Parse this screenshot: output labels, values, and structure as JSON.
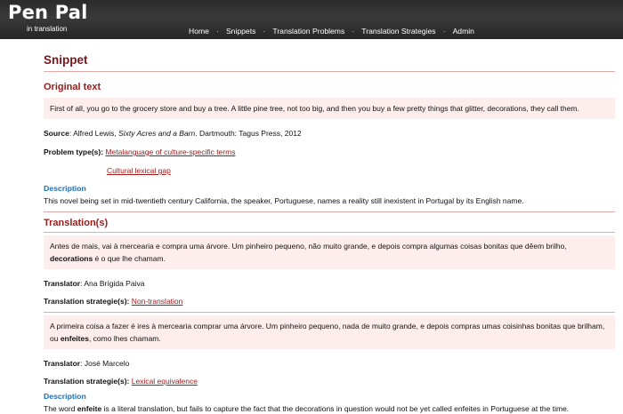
{
  "brand": {
    "title": "Pen Pal",
    "subtitle": "in translation"
  },
  "nav": [
    "Home",
    "Snippets",
    "Translation Problems",
    "Translation Strategies",
    "Admin"
  ],
  "page_title": "Snippet",
  "original": {
    "heading": "Original text",
    "text": "First of all, you go to the grocery store and buy a tree. A little pine tree, not too big, and then you buy a few pretty things that glitter, decorations, they call them.",
    "source_label": "Source",
    "source_author": "Alfred Lewis, ",
    "source_title": "Sixty Acres and a Barn",
    "source_rest": ". Dartmouth: Tagus Press, 2012",
    "problem_label": "Problem type(s):",
    "problem_types": [
      "Metalanguage of culture-specific terms",
      "Cultural lexical gap"
    ],
    "description_heading": "Description",
    "description": "This novel being set in mid-twentieth century California, the speaker, Portuguese, names a reality still inexistent in Portugal by its English name."
  },
  "translations": {
    "heading": "Translation(s)",
    "items": [
      {
        "text_a": "Antes de mais, vai à mercearia e compra uma árvore. Um pinheiro pequeno, não muito grande, e depois compra algumas coisas bonitas que dêem brilho, ",
        "bold": "decorations",
        "text_b": " é o que lhe chamam.",
        "translator_label": "Translator",
        "translator": "Ana Brígida Paiva",
        "strategy_label": "Translation strategie(s):",
        "strategy": "Non-translation"
      },
      {
        "text_a": "A primeira coisa a fazer é ires à mercearia comprar uma árvore. Um pinheiro pequeno, nada de muito grande, e depois compras umas coisinhas bonitas que brilham, ou ",
        "bold": "enfeites",
        "text_b": ", como lhes chamam.",
        "translator_label": "Translator",
        "translator": "José Marcelo",
        "strategy_label": "Translation strategie(s):",
        "strategy": "Lexical equivalence",
        "description_heading": "Description",
        "description_a": "The word ",
        "description_bold": "enfeite",
        "description_b": " is a literal translation, but fails to capture the fact that the decorations in question would not be yet called enfeites in Portuguese at the time."
      }
    ]
  }
}
